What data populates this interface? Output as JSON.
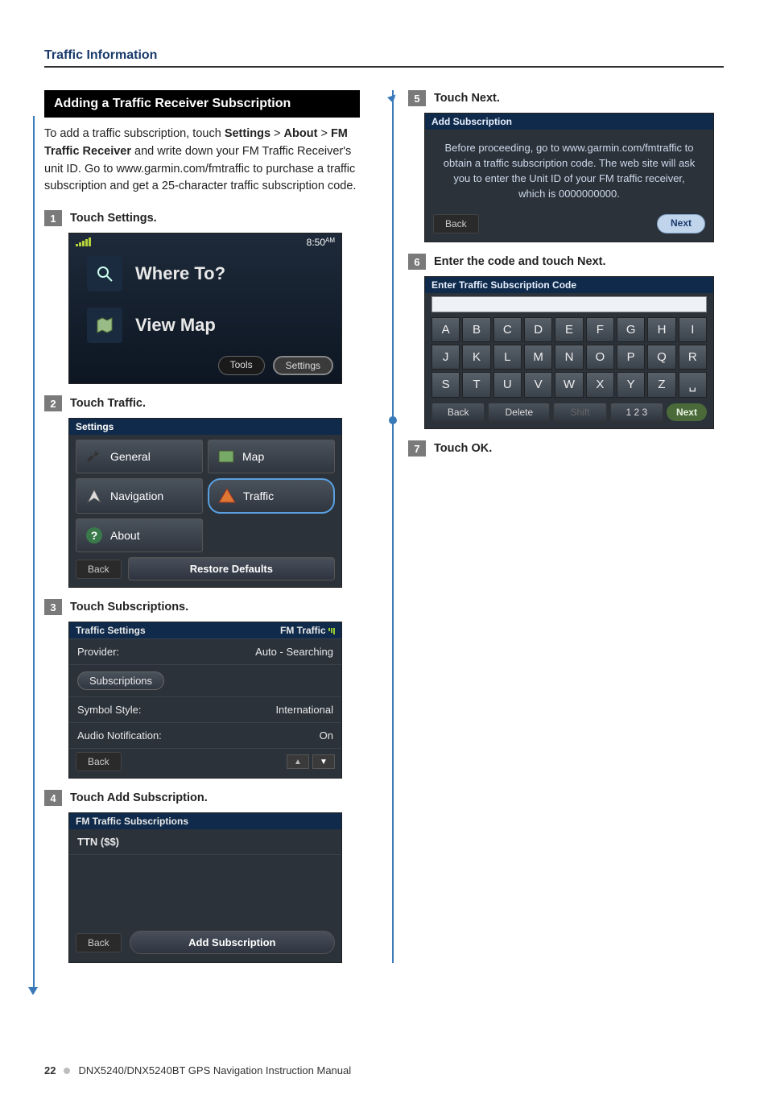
{
  "header": {
    "section": "Traffic Information"
  },
  "panel": {
    "title": "Adding a Traffic Receiver Subscription",
    "intro_parts": {
      "p1": "To add a traffic subscription, touch ",
      "b1": "Settings",
      "gt1": " > ",
      "b2": "About",
      "gt2": " > ",
      "b3": "FM Traffic Receiver",
      "p2": " and write down your FM Traffic Receiver's unit ID. Go to www.garmin.com/fmtraffic to purchase a traffic subscription and get a 25-character traffic subscription code."
    }
  },
  "steps": {
    "s1": {
      "n": "1",
      "label": "Touch Settings."
    },
    "s2": {
      "n": "2",
      "label": "Touch Traffic."
    },
    "s3": {
      "n": "3",
      "label": "Touch Subscriptions."
    },
    "s4": {
      "n": "4",
      "label": "Touch Add Subscription."
    },
    "s5": {
      "n": "5",
      "label": "Touch Next."
    },
    "s6": {
      "n": "6",
      "label": "Enter the code and touch Next."
    },
    "s7": {
      "n": "7",
      "label": "Touch OK."
    }
  },
  "shot1": {
    "clock": "8:50",
    "ampm": "AM",
    "where": "Where To?",
    "view": "View Map",
    "tools": "Tools",
    "settings": "Settings"
  },
  "shot2": {
    "title": "Settings",
    "general": "General",
    "map": "Map",
    "navigation": "Navigation",
    "traffic": "Traffic",
    "about": "About",
    "back": "Back",
    "restore": "Restore Defaults"
  },
  "shot3": {
    "title": "Traffic Settings",
    "fm": "FM Traffic",
    "rows": {
      "provider": {
        "k": "Provider:",
        "v": "Auto - Searching"
      },
      "subs": {
        "k": "Subscriptions"
      },
      "style": {
        "k": "Symbol Style:",
        "v": "International"
      },
      "audio": {
        "k": "Audio Notification:",
        "v": "On"
      }
    },
    "back": "Back"
  },
  "shot4": {
    "title": "FM Traffic Subscriptions",
    "item": "TTN ($$)",
    "back": "Back",
    "add": "Add Subscription"
  },
  "shot5": {
    "title": "Add Subscription",
    "msg": "Before proceeding, go to www.garmin.com/fmtraffic to obtain a traffic subscription code.  The web site will ask you to enter the Unit ID of your FM traffic receiver, which is 0000000000.",
    "back": "Back",
    "next": "Next"
  },
  "shot6": {
    "title": "Enter Traffic Subscription Code",
    "keys": [
      "A",
      "B",
      "C",
      "D",
      "E",
      "F",
      "G",
      "H",
      "I",
      "J",
      "K",
      "L",
      "M",
      "N",
      "O",
      "P",
      "Q",
      "R",
      "S",
      "T",
      "U",
      "V",
      "W",
      "X",
      "Y",
      "Z",
      "␣"
    ],
    "back": "Back",
    "delete": "Delete",
    "shift": "Shift",
    "num": "1 2 3",
    "next": "Next"
  },
  "footer": {
    "page": "22",
    "title": "DNX5240/DNX5240BT GPS Navigation Instruction Manual"
  }
}
